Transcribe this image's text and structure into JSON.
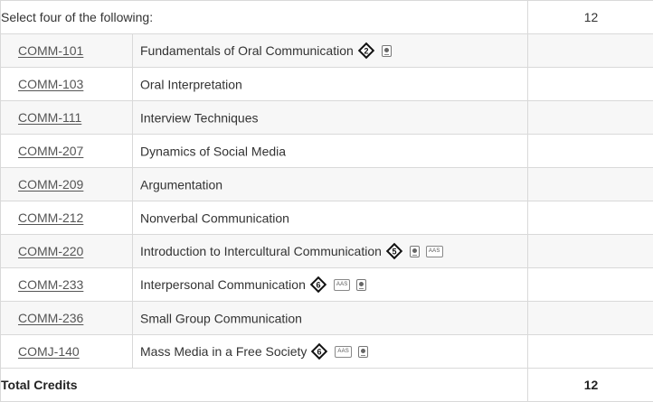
{
  "header": {
    "instruction": "Select four of the following:",
    "credits": "12"
  },
  "courses": [
    {
      "code": "COMM-101",
      "title": "Fundamentals of Oral Communication",
      "attrs": [
        "diamond-2",
        "globe"
      ]
    },
    {
      "code": "COMM-103",
      "title": "Oral Interpretation",
      "attrs": []
    },
    {
      "code": "COMM-111",
      "title": "Interview Techniques",
      "attrs": []
    },
    {
      "code": "COMM-207",
      "title": "Dynamics of Social Media",
      "attrs": []
    },
    {
      "code": "COMM-209",
      "title": "Argumentation",
      "attrs": []
    },
    {
      "code": "COMM-212",
      "title": "Nonverbal Communication",
      "attrs": []
    },
    {
      "code": "COMM-220",
      "title": "Introduction to Intercultural Communication",
      "attrs": [
        "diamond-5",
        "globe",
        "aas"
      ]
    },
    {
      "code": "COMM-233",
      "title": "Interpersonal Communication",
      "attrs": [
        "diamond-6",
        "aas",
        "globe"
      ]
    },
    {
      "code": "COMM-236",
      "title": "Small Group Communication",
      "attrs": []
    },
    {
      "code": "COMJ-140",
      "title": "Mass Media in a Free Society",
      "attrs": [
        "diamond-6",
        "aas",
        "globe"
      ]
    }
  ],
  "diamond_numbers": {
    "diamond-2": "2",
    "diamond-5": "5",
    "diamond-6": "6"
  },
  "badge_text": {
    "aas": "AAS"
  },
  "icon_names": {
    "diamond": "numbered-diamond-icon",
    "globe": "globe-badge-icon",
    "aas": "aas-badge-icon"
  },
  "total": {
    "label": "Total Credits",
    "credits": "12"
  },
  "colors": {
    "link": "#555555",
    "stripe": "#f7f7f7",
    "border": "#d9d9d9"
  }
}
